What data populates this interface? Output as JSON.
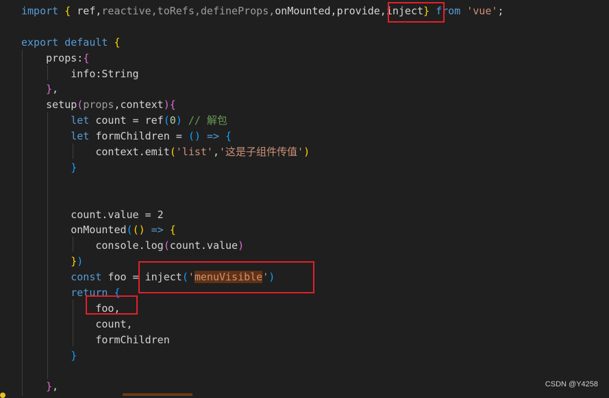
{
  "editor": {
    "lines": [
      [
        [
          "import",
          "k"
        ],
        [
          " ",
          "t"
        ],
        [
          "{",
          "y"
        ],
        [
          " ref,",
          "t"
        ],
        [
          "reactive,toRefs,defineProps,",
          "d"
        ],
        [
          "onMounted,provide,inject",
          "t"
        ],
        [
          "}",
          "y"
        ],
        [
          " ",
          "t"
        ],
        [
          "from",
          "k"
        ],
        [
          " ",
          "t"
        ],
        [
          "'vue'",
          "s"
        ],
        [
          ";",
          "t"
        ]
      ],
      [],
      [
        [
          "export",
          "k"
        ],
        [
          " ",
          "t"
        ],
        [
          "default",
          "k"
        ],
        [
          " ",
          "t"
        ],
        [
          "{",
          "y"
        ]
      ],
      [
        [
          "    props:",
          "t"
        ],
        [
          "{",
          "p"
        ]
      ],
      [
        [
          "        info:String",
          "t"
        ]
      ],
      [
        [
          "    ",
          "t"
        ],
        [
          "}",
          "p"
        ],
        [
          ",",
          "t"
        ]
      ],
      [
        [
          "    setup",
          "t"
        ],
        [
          "(",
          "p"
        ],
        [
          "props",
          "d"
        ],
        [
          ",context",
          "t"
        ],
        [
          ")",
          "p"
        ],
        [
          "{",
          "p"
        ]
      ],
      [
        [
          "        ",
          "t"
        ],
        [
          "let",
          "k"
        ],
        [
          " count = ref",
          "t"
        ],
        [
          "(",
          "b"
        ],
        [
          "0",
          "n"
        ],
        [
          ")",
          "b"
        ],
        [
          " ",
          "t"
        ],
        [
          "// 解包",
          "c"
        ]
      ],
      [
        [
          "        ",
          "t"
        ],
        [
          "let",
          "k"
        ],
        [
          " formChildren = ",
          "t"
        ],
        [
          "()",
          "b"
        ],
        [
          " ",
          "t"
        ],
        [
          "=>",
          "k"
        ],
        [
          " ",
          "t"
        ],
        [
          "{",
          "b"
        ]
      ],
      [
        [
          "            context.emit",
          "t"
        ],
        [
          "(",
          "y"
        ],
        [
          "'list'",
          "s"
        ],
        [
          ",",
          "t"
        ],
        [
          "'这是子组件传值'",
          "s"
        ],
        [
          ")",
          "y"
        ]
      ],
      [
        [
          "        ",
          "t"
        ],
        [
          "}",
          "b"
        ]
      ],
      [],
      [],
      [
        [
          "        count.value = 2",
          "t"
        ]
      ],
      [
        [
          "        onMounted",
          "t"
        ],
        [
          "(",
          "b"
        ],
        [
          "()",
          "y"
        ],
        [
          " ",
          "t"
        ],
        [
          "=>",
          "k"
        ],
        [
          " ",
          "t"
        ],
        [
          "{",
          "y"
        ]
      ],
      [
        [
          "            console.log",
          "t"
        ],
        [
          "(",
          "p"
        ],
        [
          "count.value",
          "t"
        ],
        [
          ")",
          "p"
        ]
      ],
      [
        [
          "        ",
          "t"
        ],
        [
          "}",
          "y"
        ],
        [
          ")",
          "b"
        ]
      ],
      [
        [
          "        ",
          "t"
        ],
        [
          "const",
          "k"
        ],
        [
          " foo = inject",
          "t"
        ],
        [
          "(",
          "b"
        ],
        [
          "'",
          "s"
        ],
        [
          "menuVisible",
          "h"
        ],
        [
          "'",
          "s"
        ],
        [
          ")",
          "b"
        ]
      ],
      [
        [
          "        ",
          "t"
        ],
        [
          "return",
          "k"
        ],
        [
          " ",
          "t"
        ],
        [
          "{",
          "b"
        ]
      ],
      [
        [
          "            foo,",
          "t"
        ]
      ],
      [
        [
          "            count,",
          "t"
        ]
      ],
      [
        [
          "            formChildren",
          "t"
        ]
      ],
      [
        [
          "        ",
          "t"
        ],
        [
          "}",
          "b"
        ]
      ],
      [],
      [
        [
          "    ",
          "t"
        ],
        [
          "}",
          "p"
        ],
        [
          ",",
          "t"
        ]
      ]
    ]
  },
  "colors": {
    "keyword": "#569cd6",
    "string": "#ce9178",
    "comment": "#6a9955",
    "highlight": "#613214",
    "annotation_box": "#e5202a",
    "background": "#1f1f1f"
  },
  "watermark": "CSDN @Y4258"
}
